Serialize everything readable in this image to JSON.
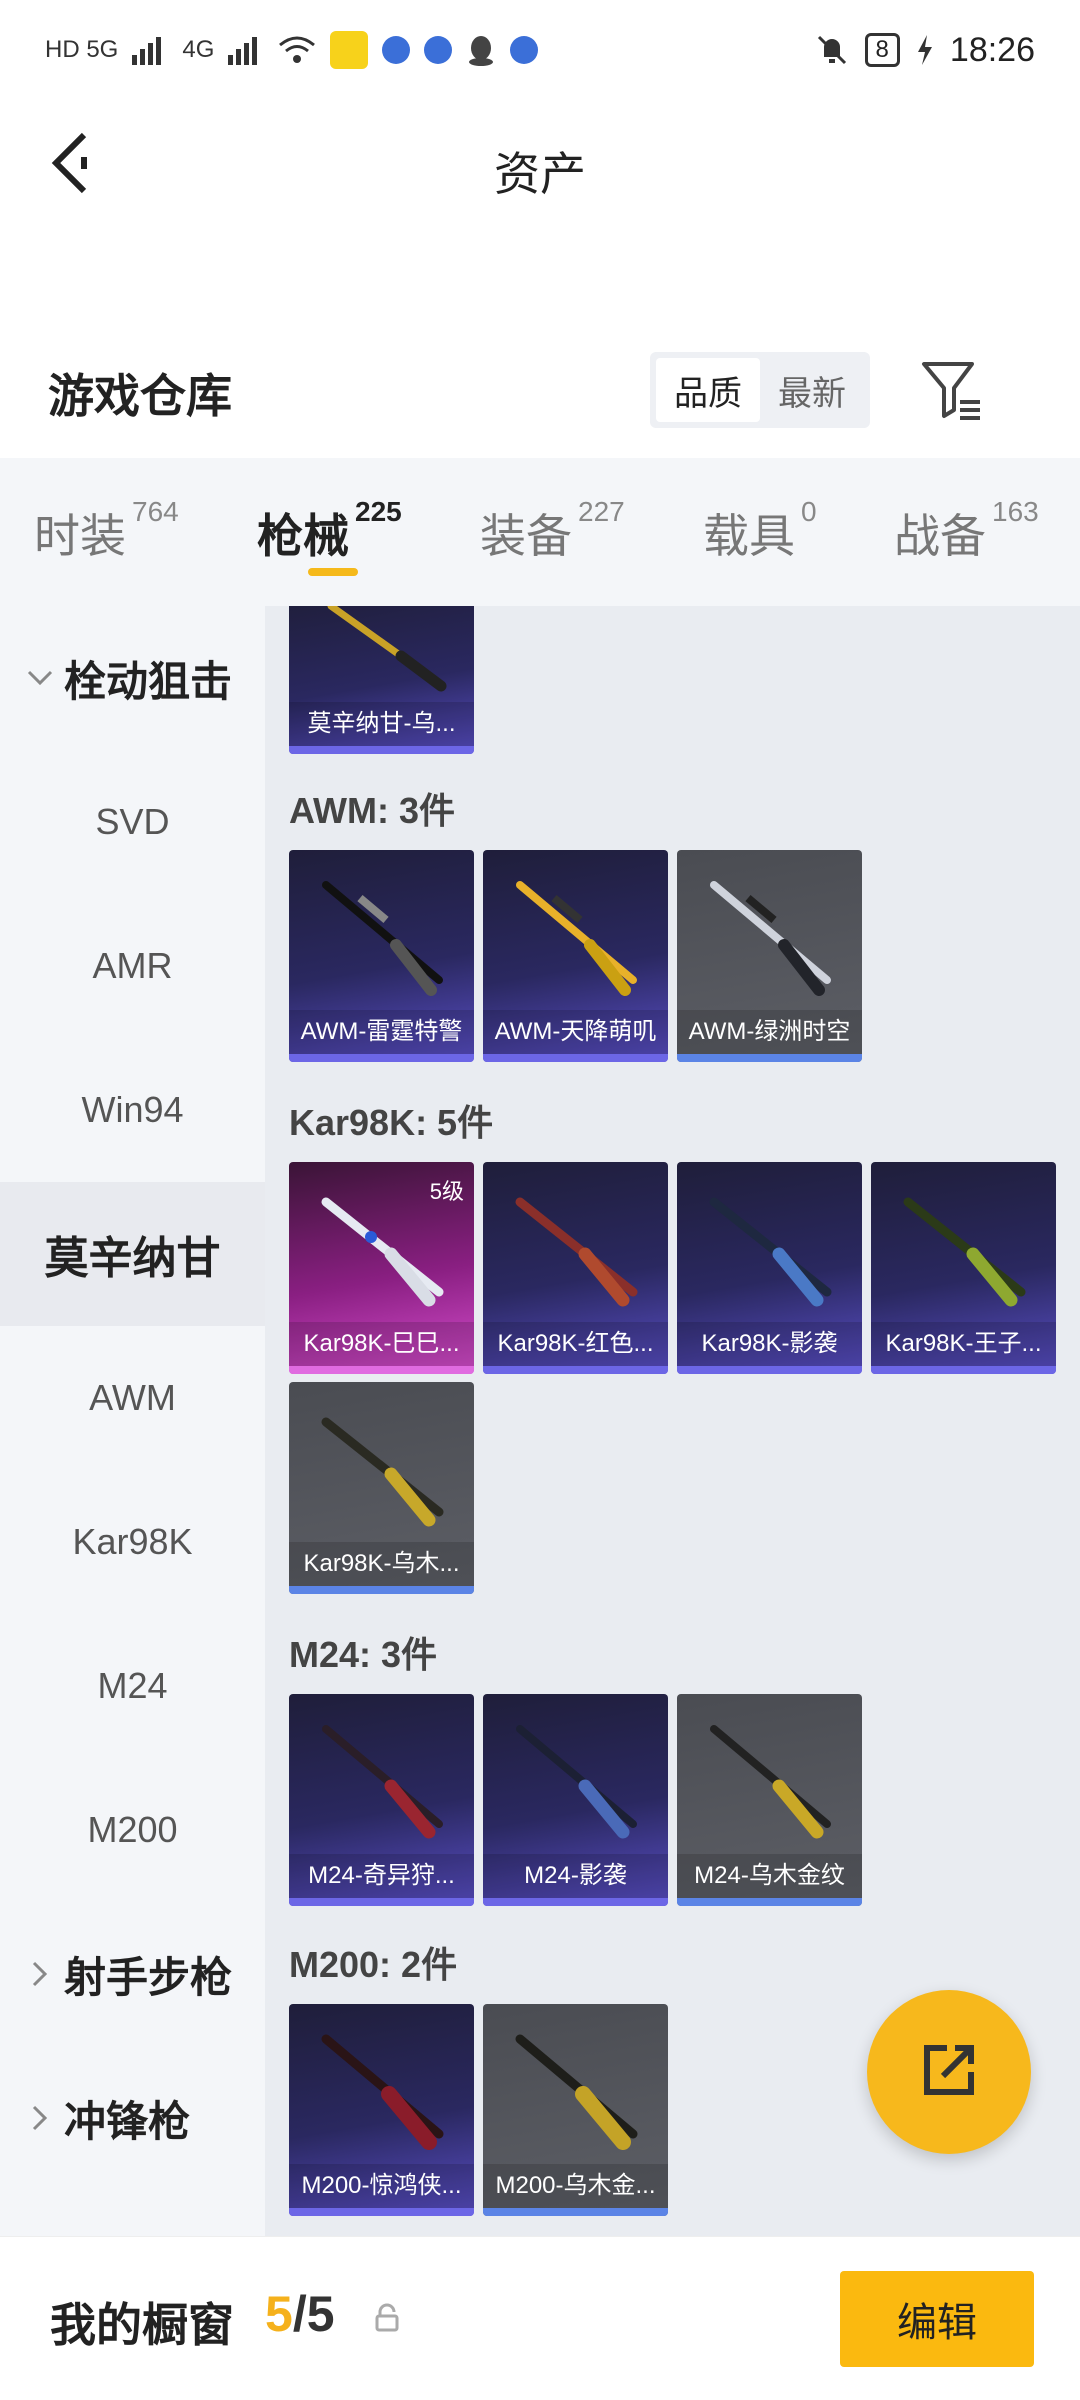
{
  "status_bar": {
    "network_left": "HD 5G",
    "network_right": "4G",
    "battery": "8",
    "time": "18:26",
    "icons": [
      "hd-icon",
      "signal-icon",
      "signal-icon",
      "wifi-icon",
      "app-icon",
      "app-dot-icon",
      "app-dot-icon",
      "qq-icon",
      "app-dot-icon",
      "mute-icon",
      "battery-icon",
      "charging-icon"
    ]
  },
  "header": {
    "title": "资产",
    "back_icon": "back-arrow-icon"
  },
  "warehouse": {
    "title": "游戏仓库",
    "sort_options": [
      "品质",
      "最新"
    ],
    "filter_icon": "filter-icon"
  },
  "tabs": [
    {
      "label": "时装",
      "count": "764"
    },
    {
      "label": "枪械",
      "count": "225"
    },
    {
      "label": "装备",
      "count": "227"
    },
    {
      "label": "载具",
      "count": "0"
    },
    {
      "label": "战备",
      "count": "163"
    }
  ],
  "sidebar": [
    {
      "label": "栓动狙击"
    },
    {
      "label": "SVD"
    },
    {
      "label": "AMR"
    },
    {
      "label": "Win94"
    },
    {
      "label": "莫辛纳甘"
    },
    {
      "label": "AWM"
    },
    {
      "label": "Kar98K"
    },
    {
      "label": "M24"
    },
    {
      "label": "M200"
    },
    {
      "label": "射手步枪"
    },
    {
      "label": "冲锋枪"
    }
  ],
  "content": {
    "top_card": {
      "label": "莫辛纳甘-乌..."
    },
    "awm_title": "AWM: 3件",
    "awm": [
      {
        "label": "AWM-雷霆特警"
      },
      {
        "label": "AWM-天降萌叽"
      },
      {
        "label": "AWM-绿洲时空"
      }
    ],
    "kar_title": "Kar98K: 5件",
    "kar": [
      {
        "label": "Kar98K-巳巳...",
        "level": "5级"
      },
      {
        "label": "Kar98K-红色..."
      },
      {
        "label": "Kar98K-影袭"
      },
      {
        "label": "Kar98K-王子..."
      },
      {
        "label": "Kar98K-乌木..."
      }
    ],
    "m24_title": "M24: 3件",
    "m24": [
      {
        "label": "M24-奇异狩..."
      },
      {
        "label": "M24-影袭"
      },
      {
        "label": "M24-乌木金纹"
      }
    ],
    "m200_title": "M200: 2件",
    "m200": [
      {
        "label": "M200-惊鸿侠..."
      },
      {
        "label": "M200-乌木金..."
      }
    ]
  },
  "fab": {
    "icon": "share-icon"
  },
  "bottom": {
    "title": "我的橱窗",
    "count_current": "5",
    "count_sep_total": "/5",
    "lock_icon": "lock-icon",
    "edit_label": "编辑"
  }
}
